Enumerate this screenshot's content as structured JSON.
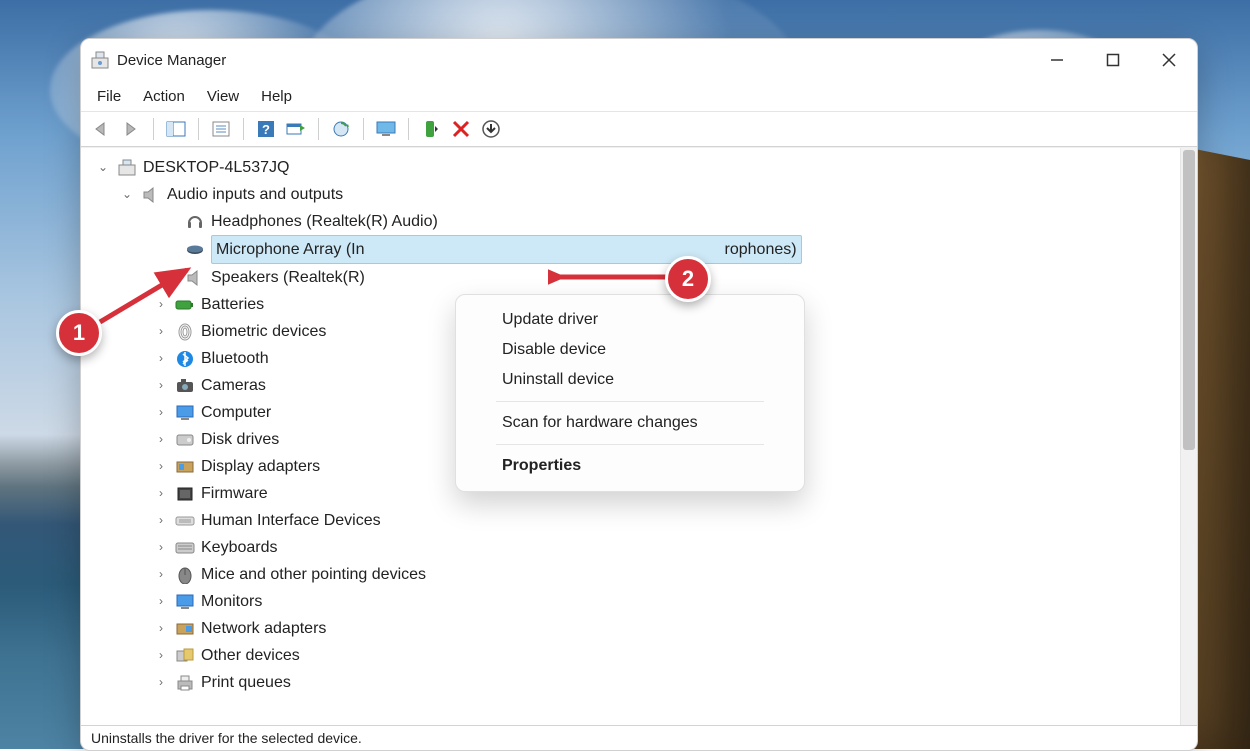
{
  "window": {
    "title": "Device Manager"
  },
  "menu": {
    "file": "File",
    "action": "Action",
    "view": "View",
    "help": "Help"
  },
  "tree": {
    "root": "DESKTOP-4L537JQ",
    "audio_category": "Audio inputs and outputs",
    "audio": {
      "headphones": "Headphones (Realtek(R) Audio)",
      "microphone_prefix": "Microphone Array (In",
      "microphone_suffix": "rophones)",
      "speakers_prefix": "Speakers (Realtek(R) "
    },
    "categories": {
      "batteries": "Batteries",
      "biometric": "Biometric devices",
      "bluetooth": "Bluetooth",
      "cameras": "Cameras",
      "computer": "Computer",
      "disk": "Disk drives",
      "display": "Display adapters",
      "firmware": "Firmware",
      "hid": "Human Interface Devices",
      "keyboards": "Keyboards",
      "mice": "Mice and other pointing devices",
      "monitors": "Monitors",
      "network": "Network adapters",
      "other": "Other devices",
      "print": "Print queues"
    }
  },
  "context_menu": {
    "update": "Update driver",
    "disable": "Disable device",
    "uninstall": "Uninstall device",
    "scan": "Scan for hardware changes",
    "properties": "Properties"
  },
  "statusbar": {
    "text": "Uninstalls the driver for the selected device."
  },
  "callouts": {
    "one": "1",
    "two": "2"
  }
}
